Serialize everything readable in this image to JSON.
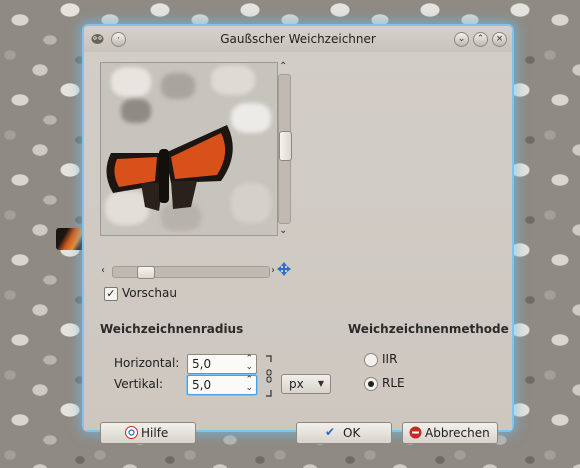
{
  "window": {
    "title": "Gaußscher Weichzeichner"
  },
  "preview": {
    "checkbox_label": "Vorschau",
    "checked": true
  },
  "radius": {
    "heading": "Weichzeichnenradius",
    "horizontal_label": "Horizontal:",
    "horizontal_value": "5,0",
    "vertical_label": "Vertikal:",
    "vertical_value": "5,0",
    "unit": "px"
  },
  "method": {
    "heading": "Weichzeichnenmethode",
    "options": [
      {
        "label": "IIR",
        "selected": false
      },
      {
        "label": "RLE",
        "selected": true
      }
    ]
  },
  "buttons": {
    "help": "Hilfe",
    "ok": "OK",
    "cancel": "Abbrechen"
  },
  "colors": {
    "focus": "#4a9fe0",
    "window_glow": "#7fc4ea",
    "ok_check": "#2c6bbf",
    "cancel_icon": "#c62a22"
  }
}
